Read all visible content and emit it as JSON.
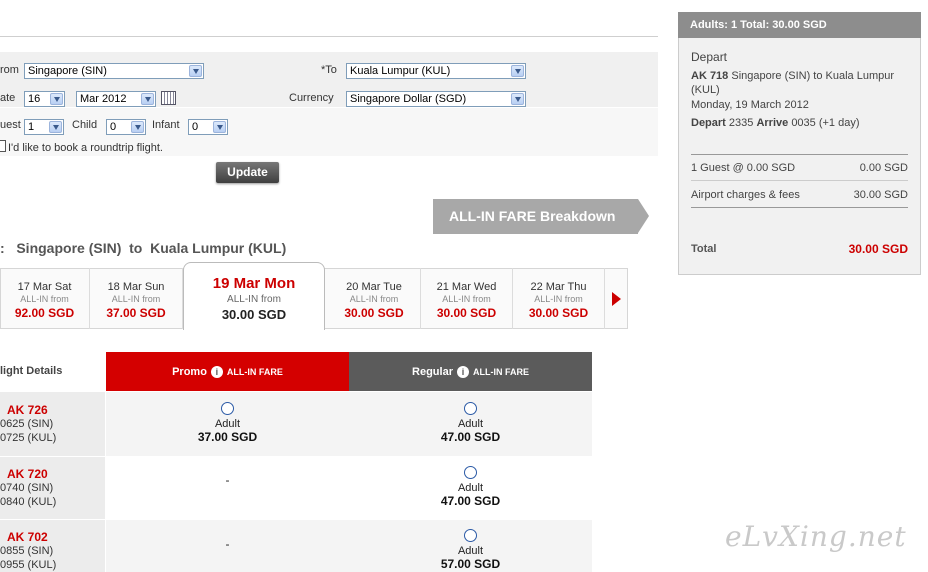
{
  "search_form": {
    "from_label": "rom",
    "from_value": "Singapore (SIN)",
    "to_label": "*To",
    "to_value": "Kuala Lumpur (KUL)",
    "date_label": "ate",
    "day_value": "16",
    "month_value": "Mar 2012",
    "currency_label": "Currency",
    "currency_value": "Singapore Dollar (SGD)",
    "guest_label": "uest",
    "guest_value": "1",
    "child_label": "Child",
    "child_value": "0",
    "infant_label": "Infant",
    "infant_value": "0",
    "roundtrip_label": "I'd like to book a roundtrip flight.",
    "update_button": "Update"
  },
  "breakdown_button": "ALL-IN FARE Breakdown",
  "route": {
    "prefix": ":",
    "from": "Singapore (SIN)",
    "joiner": "to",
    "to": "Kuala Lumpur (KUL)"
  },
  "date_tabs": [
    {
      "date": "17 Mar Sat",
      "caption": "ALL-IN from",
      "price": "92.00 SGD"
    },
    {
      "date": "18 Mar Sun",
      "caption": "ALL-IN from",
      "price": "37.00 SGD"
    },
    {
      "date": "19 Mar Mon",
      "caption": "ALL-IN from",
      "price": "30.00 SGD",
      "selected": true
    },
    {
      "date": "20 Mar Tue",
      "caption": "ALL-IN from",
      "price": "30.00 SGD"
    },
    {
      "date": "21 Mar Wed",
      "caption": "ALL-IN from",
      "price": "30.00 SGD"
    },
    {
      "date": "22 Mar Thu",
      "caption": "ALL-IN from",
      "price": "30.00 SGD"
    }
  ],
  "table": {
    "flight_details_header": "light Details",
    "promo_header": "Promo",
    "regular_header": "Regular",
    "fare_tag": "ALL-IN FARE",
    "info_glyph": "i",
    "rows": [
      {
        "flight": "AK  726",
        "dep": "0625  (SIN)",
        "arr": "0725  (KUL)",
        "promo": {
          "available": true,
          "pax": "Adult",
          "fare": "37.00 SGD"
        },
        "regular": {
          "available": true,
          "pax": "Adult",
          "fare": "47.00 SGD"
        }
      },
      {
        "flight": "AK  720",
        "dep": "0740  (SIN)",
        "arr": "0840  (KUL)",
        "promo": {
          "available": false,
          "dash": "-"
        },
        "regular": {
          "available": true,
          "pax": "Adult",
          "fare": "47.00 SGD"
        }
      },
      {
        "flight": "AK  702",
        "dep": "0855  (SIN)",
        "arr": "0955  (KUL)",
        "promo": {
          "available": false,
          "dash": "-"
        },
        "regular": {
          "available": true,
          "pax": "Adult",
          "fare": "57.00 SGD"
        }
      }
    ]
  },
  "summary": {
    "header": "Adults: 1  Total: 30.00 SGD",
    "section": "Depart",
    "flight_no": "AK 718",
    "route": "Singapore (SIN) to Kuala Lumpur (KUL)",
    "date": "Monday, 19 March 2012",
    "depart_label": "Depart",
    "depart_time": "2335",
    "arrive_label": "Arrive",
    "arrive_time": "0035 (+1 day)",
    "guest_line_label": "1 Guest @ 0.00 SGD",
    "guest_line_value": "0.00 SGD",
    "fees_label": "Airport charges & fees",
    "fees_value": "30.00 SGD",
    "total_label": "Total",
    "total_value": "30.00 SGD"
  },
  "watermark": "eLvXing.net",
  "colors": {
    "accent_red": "#d40000",
    "regular_gray": "#5b5b5b",
    "price_red": "#cc0000",
    "radio_blue": "#2b5aa6"
  },
  "icons": {
    "calendar": "calendar-icon",
    "next": "next-arrow-icon",
    "info": "info-icon"
  }
}
